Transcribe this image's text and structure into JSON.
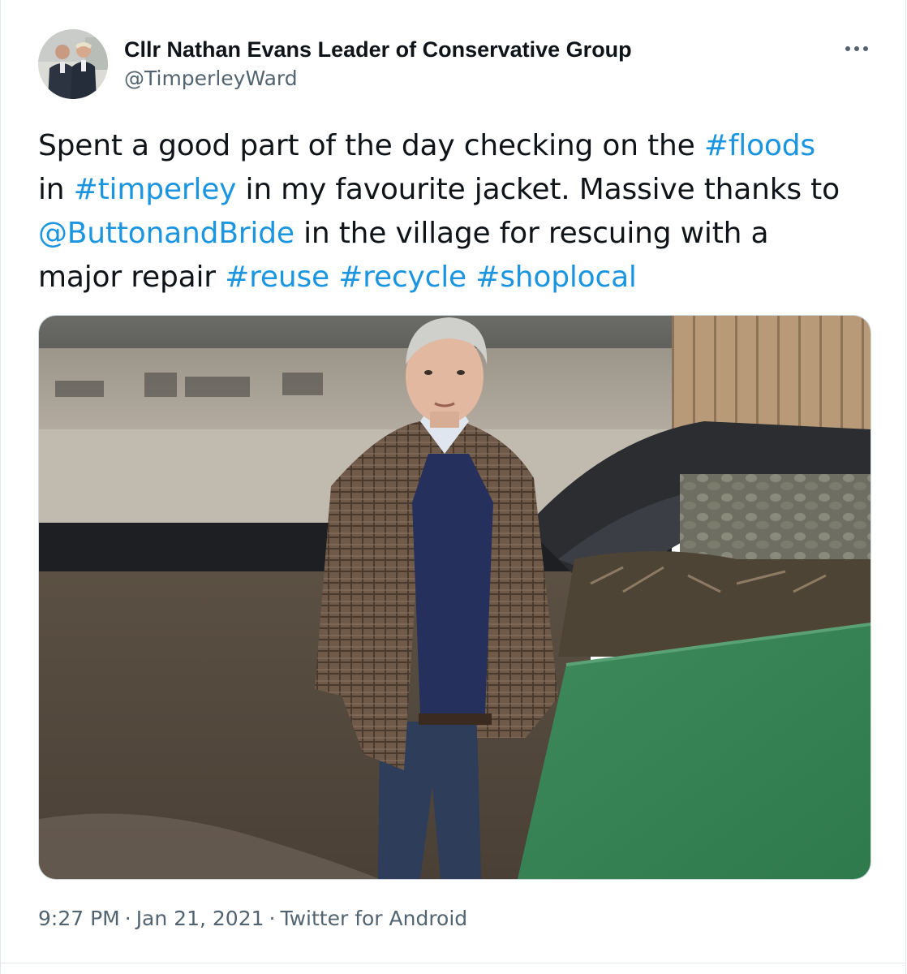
{
  "author": {
    "name": "Cllr Nathan Evans Leader of Conservative Group",
    "handle": "@TimperleyWard"
  },
  "more_icon": "more-horizontal-icon",
  "tweet": {
    "line1": {
      "t1": "Spent a good part of the day checking on the ",
      "floods": "#floods"
    },
    "line2": {
      "t1": "in ",
      "timperley": "#timperley",
      "t2": " in my favourite jacket. Massive thanks to"
    },
    "line3": {
      "mention": "@ButtonandBride",
      "t1": " in the village for rescuing with a"
    },
    "line4": {
      "t1": "major repair ",
      "reuse": "#reuse",
      "recycle": "#recycle",
      "shoplocal": "#shoplocal"
    }
  },
  "meta": {
    "time": "9:27 PM",
    "date": "Jan 21, 2021",
    "source": "Twitter for Android",
    "separator": "·"
  },
  "colors": {
    "link": "#1b95e0",
    "text": "#0f1419",
    "secondary": "#536471",
    "border": "#e1e8ed"
  }
}
